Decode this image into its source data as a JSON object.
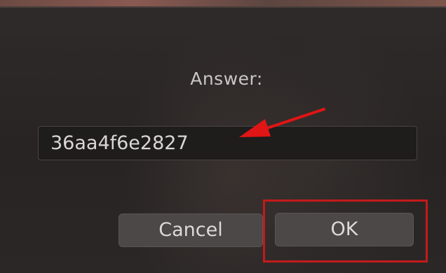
{
  "dialog": {
    "prompt_label": "Answer:",
    "answer_value": "36aa4f6e2827",
    "cancel_label": "Cancel",
    "ok_label": "OK"
  },
  "annotations": {
    "arrow_color": "#e01515",
    "highlight_color": "#c41a1a"
  },
  "colors": {
    "background": "#2a2625",
    "field_background": "#1f1c1c",
    "button_background": "#4c4847",
    "text": "#d9d7d5"
  }
}
